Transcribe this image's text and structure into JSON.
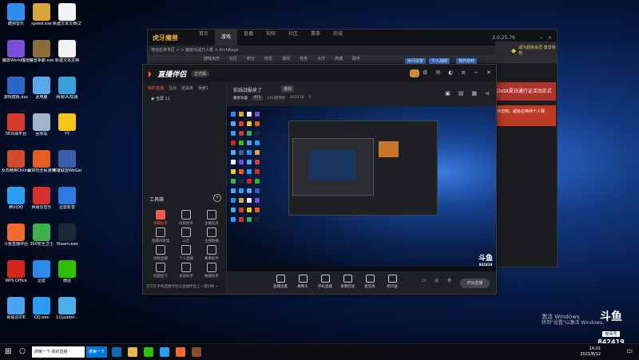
{
  "desktop_icons": [
    {
      "label": "酷狗音乐",
      "color": "#2d8cf0"
    },
    {
      "label": "speed.exe",
      "color": "#d9a43a"
    },
    {
      "label": "新建文本文档(2)",
      "color": "#f2f2f2"
    },
    {
      "label": "魔兽World魔兽",
      "color": "#7a4ed8"
    },
    {
      "label": "魔兽争霸.exe",
      "color": "#8a6d3b"
    },
    {
      "label": "新建文本文档",
      "color": "#f2f2f2"
    },
    {
      "label": "游戏模板.doc",
      "color": "#2b65c8"
    },
    {
      "label": "此电脑",
      "color": "#58a7e8"
    },
    {
      "label": "网易UU加速",
      "color": "#3aa0d8"
    },
    {
      "label": "5E对战平台",
      "color": "#d63b2e"
    },
    {
      "label": "回收站",
      "color": "#9fb6cc"
    },
    {
      "label": "YY",
      "color": "#f5c518"
    },
    {
      "label": "反恐精英Online",
      "color": "#d34a2c"
    },
    {
      "label": "最好玩全民游戏",
      "color": "#e55e1e"
    },
    {
      "label": "英雄联盟WeGame",
      "color": "#3a5fa8"
    },
    {
      "label": "腾讯QQ",
      "color": "#2a9df4"
    },
    {
      "label": "网易云音乐",
      "color": "#d8302e"
    },
    {
      "label": "迅雷影音",
      "color": "#2d7be0"
    },
    {
      "label": "斗鱼直播伴侣",
      "color": "#f26a2e"
    },
    {
      "label": "360安全卫士",
      "color": "#3bb34a"
    },
    {
      "label": "Steam.exe",
      "color": "#1b2838"
    },
    {
      "label": "WPS Office",
      "color": "#d4261d"
    },
    {
      "label": "迅雷",
      "color": "#2a8be8"
    },
    {
      "label": "微信",
      "color": "#2dc100"
    },
    {
      "label": "易语言IDE",
      "color": "#4aa3f0"
    },
    {
      "label": "QQ.exe",
      "color": "#2a9df4"
    },
    {
      "label": "11Loader...",
      "color": "#4cb0e8"
    }
  ],
  "back_window": {
    "logo": "虎牙魔兽",
    "version": "2.0.25.76",
    "tabs": [
      "首页",
      "游戏",
      "直播",
      "视频",
      "社区",
      "赛事",
      "商城"
    ],
    "active_tab": "游戏",
    "breadcrumb": "电信名将专区 > > 魔兽对战万人群 > ArchAnge",
    "menu": [
      "游戏大厅",
      "社区",
      "积分",
      "好友",
      "房间",
      "任务",
      "大厅",
      "商城",
      "助手"
    ],
    "btn_room": "房间设置",
    "btn_personal": "个人战绩",
    "btn_mine": "我的游戏",
    "side_banner": "成为超级会员 尊享特权",
    "side_red": "DotA夏日通行证活动正式",
    "side_red2": "冲击吧，超级召唤师个人赛"
  },
  "main_window": {
    "logo": "直播伴侣",
    "version_badge": "正式版",
    "left_tabs": [
      "我的直播",
      "互动",
      "道具库",
      "场景1"
    ],
    "active_left_tab": "我的直播",
    "scene_label": "全屏 11",
    "tools_title": "工具箱",
    "tools": [
      {
        "label": "弹幕助手",
        "highlight": true
      },
      {
        "label": "房管助手",
        "highlight": false
      },
      {
        "label": "主播任务",
        "highlight": false
      },
      {
        "label": "直播间管理",
        "highlight": false
      },
      {
        "label": "公告",
        "highlight": false
      },
      {
        "label": "主播数据",
        "highlight": false
      },
      {
        "label": "视频直播",
        "highlight": false
      },
      {
        "label": "个人直播",
        "highlight": false
      },
      {
        "label": "赛事助手",
        "highlight": false
      },
      {
        "label": "适配显卡",
        "highlight": false
      },
      {
        "label": "录屏助手",
        "highlight": false
      },
      {
        "label": "数据助手",
        "highlight": false
      }
    ],
    "left_footer": "您可在手机直播伴侣与直播伴侣上一键切换 >",
    "room_title": "前线战报来了",
    "room_tag": "游戏",
    "meta": {
      "room": "魔兽争霸",
      "badge": "975",
      "status": "CPU使用率",
      "room_no": "842419",
      "count": "0"
    },
    "controls": [
      {
        "label": "直播设置"
      },
      {
        "label": "摄像头"
      },
      {
        "label": "手机直播"
      },
      {
        "label": "录像回放"
      },
      {
        "label": "麦克风"
      },
      {
        "label": "扬声器"
      }
    ],
    "start_live": "开始直播"
  },
  "taskbar": {
    "search_placeholder": "搜索一下 我的直播",
    "search_button": "搜索一下",
    "time": "14:01",
    "date": "2021/8/12",
    "apps": [
      {
        "name": "edge",
        "color": "#0f6cbd"
      },
      {
        "name": "folder",
        "color": "#e8b84a"
      },
      {
        "name": "wechat",
        "color": "#2dc100"
      },
      {
        "name": "qq",
        "color": "#2a9df4"
      },
      {
        "name": "douyu",
        "color": "#f26a2e"
      },
      {
        "name": "warcraft",
        "color": "#8a4a2c"
      }
    ]
  },
  "watermark": {
    "title": "激活 Windows",
    "subtitle": "转到\"设置\"以激活 Windows。"
  },
  "douyu_logo": {
    "name": "斗鱼",
    "label": "房间号",
    "room": "842419"
  }
}
